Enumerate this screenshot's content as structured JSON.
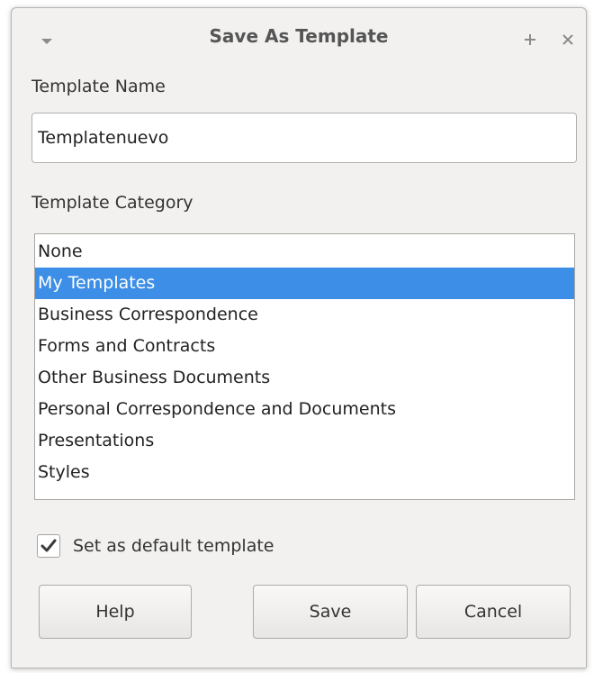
{
  "window": {
    "title": "Save As Template",
    "menu_icon": "chevron-down-icon",
    "plus_icon": "plus-icon",
    "close_icon": "close-icon"
  },
  "name_field": {
    "label": "Template Name",
    "value": "Templatenuevo"
  },
  "category": {
    "label": "Template Category",
    "items": [
      "None",
      "My Templates",
      "Business Correspondence",
      "Forms and Contracts",
      "Other Business Documents",
      "Personal Correspondence and Documents",
      "Presentations",
      "Styles"
    ],
    "selected": "My Templates"
  },
  "default_checkbox": {
    "label": "Set as default template",
    "checked": true
  },
  "buttons": {
    "help": "Help",
    "save": "Save",
    "cancel": "Cancel"
  },
  "colors": {
    "selection": "#3c8ee6",
    "window_bg": "#f2f1f0"
  }
}
